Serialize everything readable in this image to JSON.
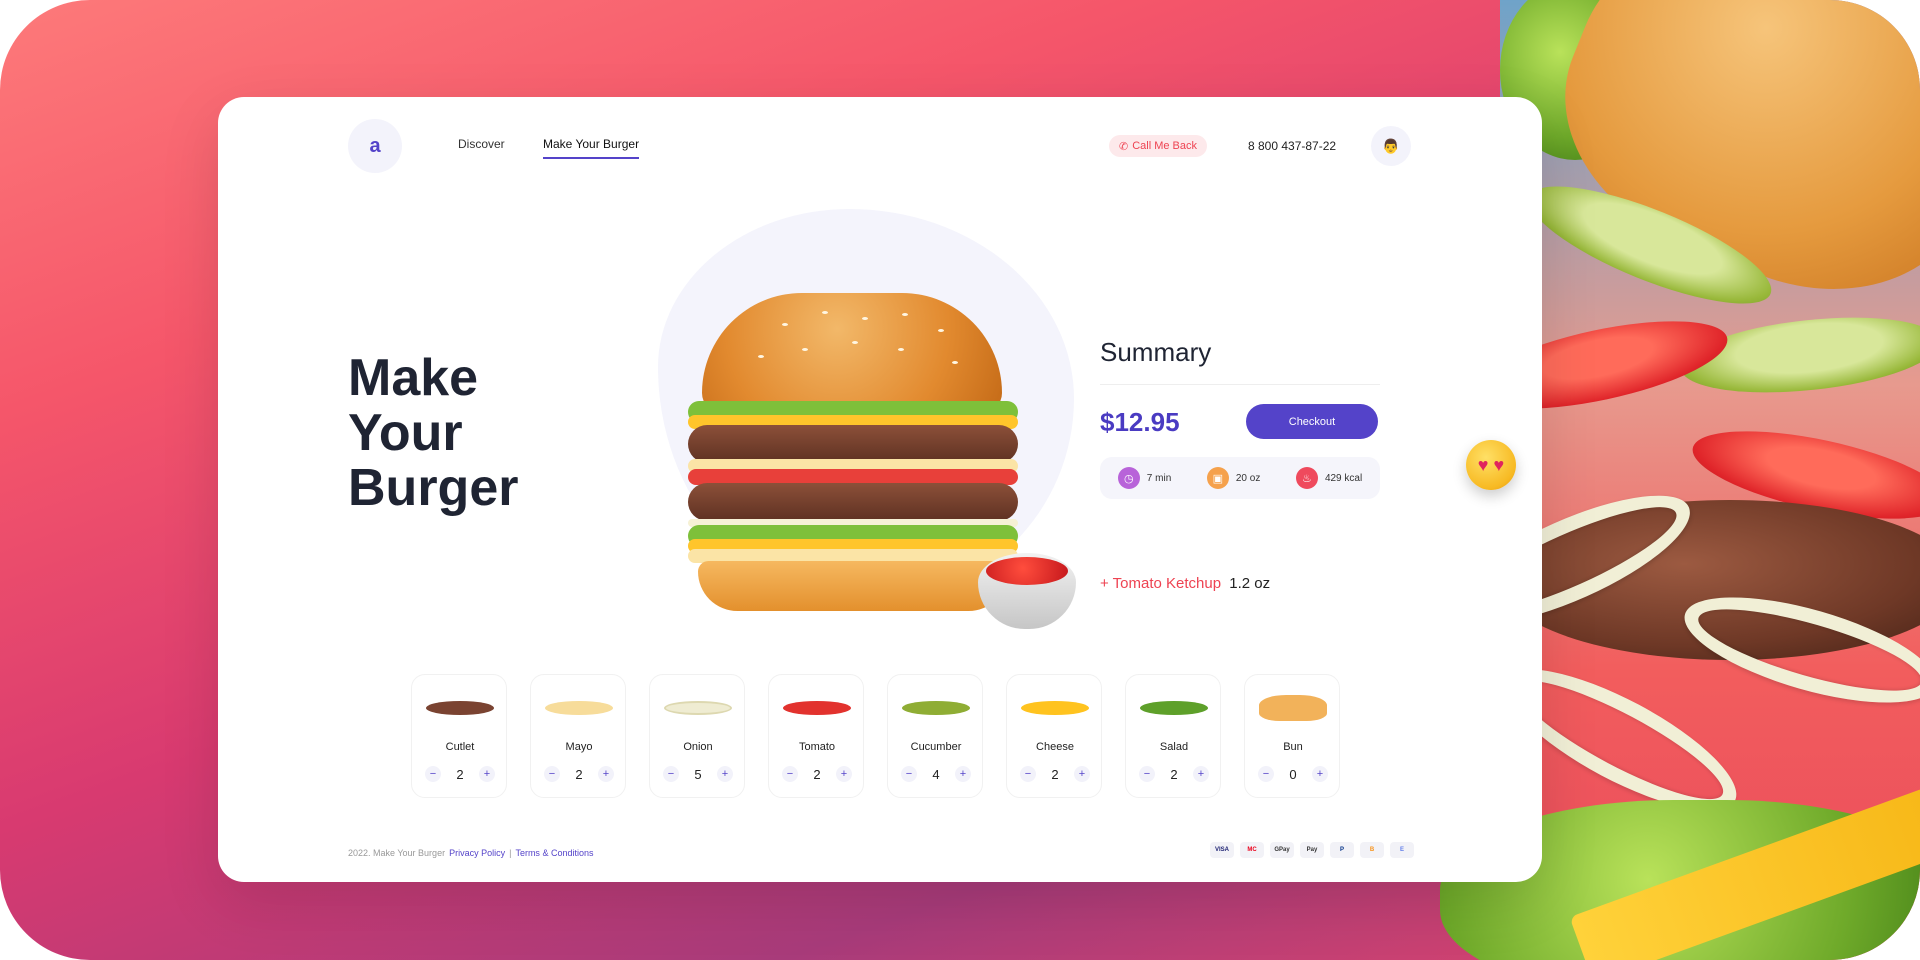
{
  "header": {
    "logo": "a",
    "nav": [
      "Discover",
      "Make Your Burger"
    ],
    "call_label": "Call Me Back",
    "phone": "8 800 437-87-22"
  },
  "hero": {
    "title": [
      "Make",
      "Your",
      "Burger"
    ]
  },
  "summary": {
    "title": "Summary",
    "price": "$12.95",
    "checkout": "Checkout",
    "stats": [
      {
        "icon": "clock-icon",
        "value": "7 min",
        "color": "#b863d9"
      },
      {
        "icon": "weight-icon",
        "value": "20 oz",
        "color": "#f5a14c"
      },
      {
        "icon": "flame-icon",
        "value": "429 kcal",
        "color": "#ef4a5d"
      }
    ],
    "extra": {
      "name": "+ Tomato Ketchup",
      "qty": "1.2 oz"
    }
  },
  "ingredients": [
    {
      "name": "Cutlet",
      "qty": "2",
      "color": "#7a4331"
    },
    {
      "name": "Mayo",
      "qty": "2",
      "color": "#f7dc9a"
    },
    {
      "name": "Onion",
      "qty": "5",
      "color": "#efecd2"
    },
    {
      "name": "Tomato",
      "qty": "2",
      "color": "#e2322e"
    },
    {
      "name": "Cucumber",
      "qty": "4",
      "color": "#8fad34"
    },
    {
      "name": "Cheese",
      "qty": "2",
      "color": "#ffc31f"
    },
    {
      "name": "Salad",
      "qty": "2",
      "color": "#5ea02a"
    },
    {
      "name": "Bun",
      "qty": "0",
      "color": "#f2b25a"
    }
  ],
  "footer": {
    "copyright": "2022. Make Your Burger",
    "privacy": "Privacy Policy",
    "separator": "|",
    "terms": "Terms & Conditions",
    "payments": [
      "VISA",
      "MC",
      "GPay",
      "Pay",
      "P",
      "B",
      "E"
    ]
  }
}
